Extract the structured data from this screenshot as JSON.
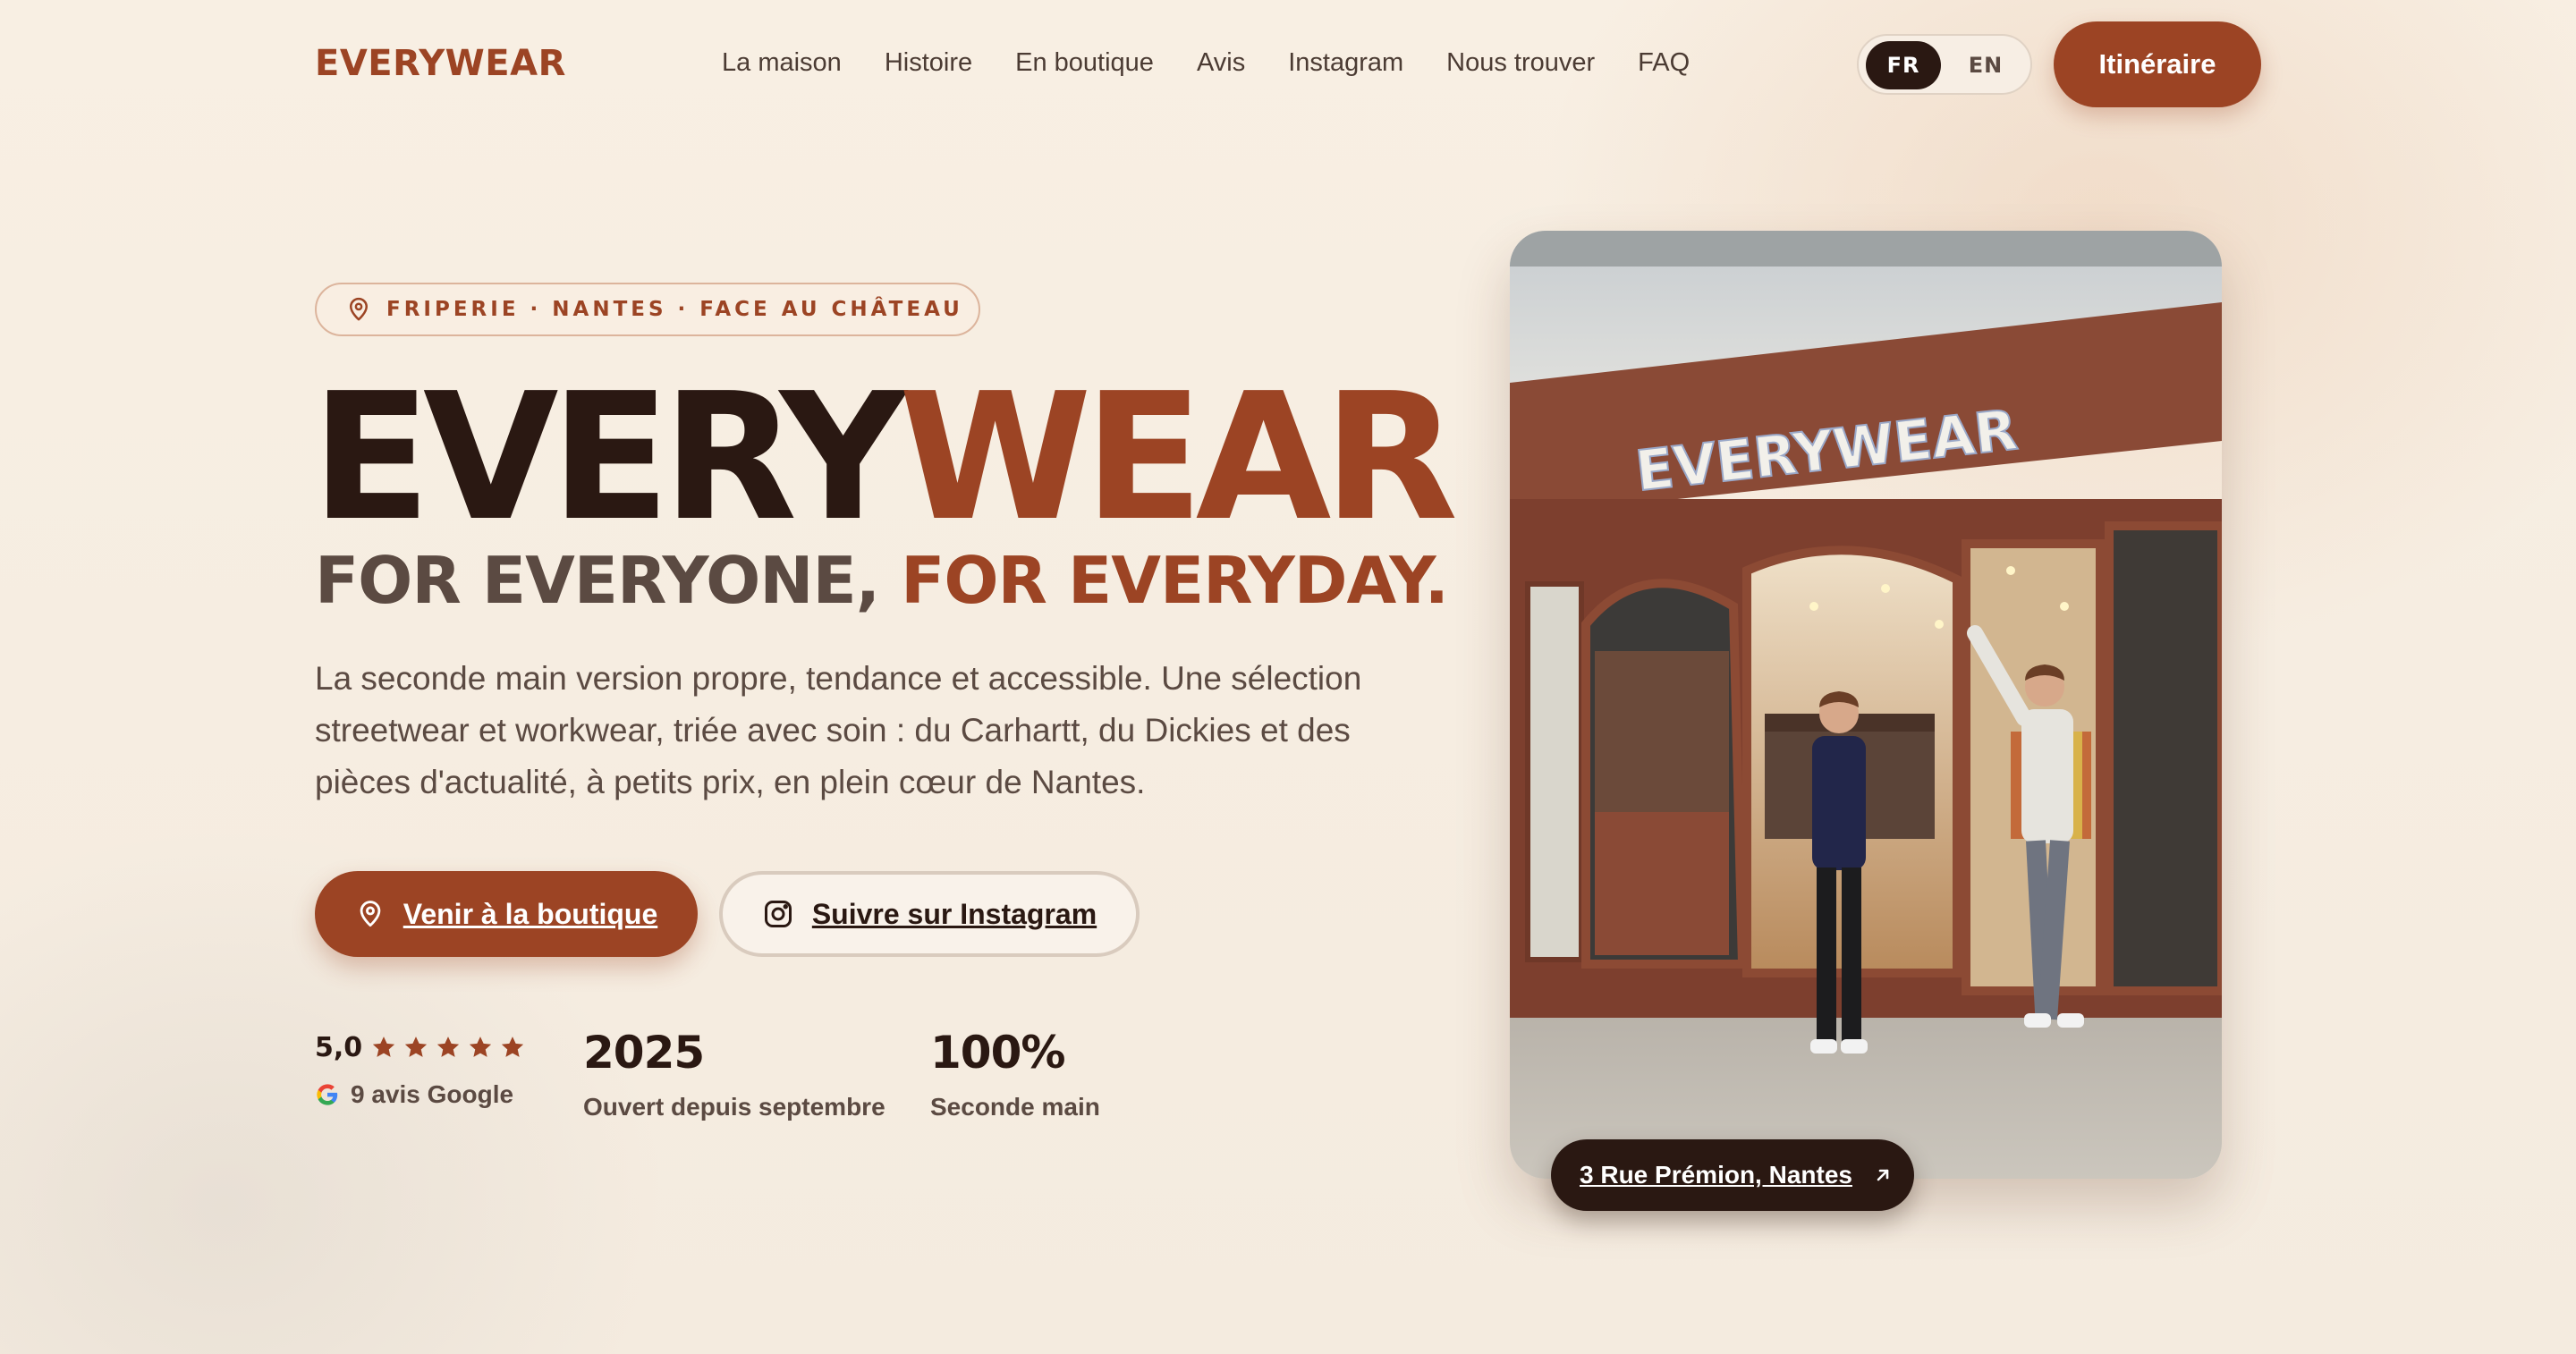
{
  "header": {
    "logo": "EVERYWEAR",
    "nav": [
      "La maison",
      "Histoire",
      "En boutique",
      "Avis",
      "Instagram",
      "Nous trouver",
      "FAQ"
    ],
    "lang": {
      "fr": "FR",
      "en": "EN",
      "active": "FR"
    },
    "cta": "Itinéraire"
  },
  "hero": {
    "tag": "FRIPERIE · NANTES · FACE AU CHÂTEAU",
    "title_a": "EVERY",
    "title_b": "WEAR",
    "subtitle_a": "FOR EVERYONE,",
    "subtitle_b": "FOR EVERYDAY.",
    "description": "La seconde main version propre, tendance et accessible. Une sélection streetwear et workwear, triée avec soin : du Carhartt, du Dickies et des pièces d'actualité, à petits prix, en plein cœur de Nantes.",
    "btn_primary": "Venir à la boutique",
    "btn_secondary": "Suivre sur Instagram"
  },
  "stats": {
    "rating": "5,0",
    "stars": 5,
    "reviews": "9 avis Google",
    "opened_value": "2025",
    "opened_label": "Ouvert depuis septembre",
    "secondhand_value": "100%",
    "secondhand_label": "Seconde main"
  },
  "photo": {
    "sign": "EVERYWEAR",
    "address": "3 Rue Prémion, Nantes"
  },
  "colors": {
    "brand": "#9c4424",
    "dark": "#2a1812",
    "background": "#f6ece0"
  }
}
